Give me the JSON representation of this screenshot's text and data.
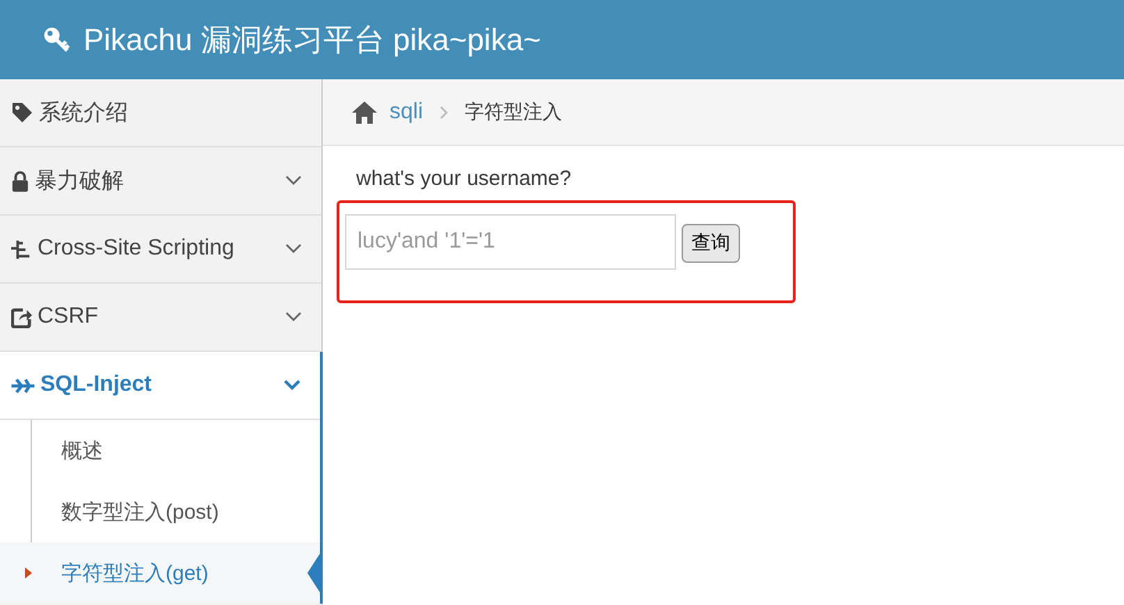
{
  "header": {
    "title": "Pikachu 漏洞练习平台 pika~pika~"
  },
  "sidebar": {
    "items": [
      {
        "label": "系统介绍",
        "selected": false
      },
      {
        "label": "暴力破解",
        "expanded": false,
        "selected": false
      },
      {
        "label": "Cross-Site Scripting",
        "expanded": false,
        "selected": false
      },
      {
        "label": "CSRF",
        "expanded": false,
        "selected": false
      },
      {
        "label": "SQL-Inject",
        "expanded": true,
        "selected": true,
        "children": [
          {
            "label": "概述",
            "selected": false
          },
          {
            "label": "数字型注入(post)",
            "selected": false
          },
          {
            "label": "字符型注入(get)",
            "selected": true
          }
        ]
      }
    ]
  },
  "breadcrumb": {
    "link": "sqli",
    "current": "字符型注入"
  },
  "form": {
    "label": "what's your username?",
    "value": "lucy'and '1'='1",
    "button": "查询"
  }
}
